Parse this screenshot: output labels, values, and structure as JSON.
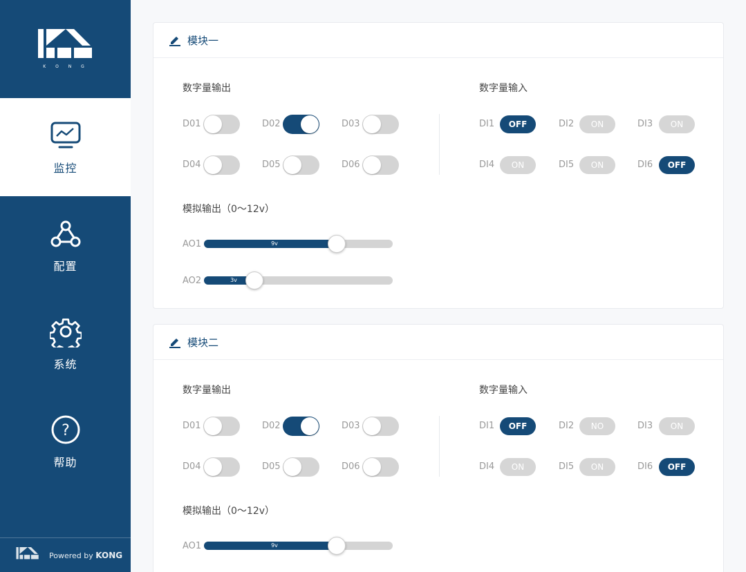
{
  "sidebar": {
    "logo_text": "K O N G",
    "items": [
      {
        "label": "监控",
        "icon": "monitor-icon",
        "active": true
      },
      {
        "label": "配置",
        "icon": "network-icon",
        "active": false
      },
      {
        "label": "系统",
        "icon": "gear-icon",
        "active": false
      },
      {
        "label": "帮助",
        "icon": "help-icon",
        "active": false
      }
    ],
    "footer": {
      "powered": "Powered by",
      "brand": "KONG"
    }
  },
  "colors": {
    "accent": "#154a77",
    "inactive": "#d4d4d4"
  },
  "modules": [
    {
      "title": "模块一",
      "digital_out_label": "数字量输出",
      "digital_in_label": "数字量输入",
      "analog_label": "模拟输出（0～12v）",
      "digital_outputs": [
        {
          "name": "D01",
          "on": false
        },
        {
          "name": "D02",
          "on": true
        },
        {
          "name": "D03",
          "on": false
        },
        {
          "name": "D04",
          "on": false
        },
        {
          "name": "D05",
          "on": false
        },
        {
          "name": "D06",
          "on": false
        }
      ],
      "digital_inputs": [
        {
          "name": "DI1",
          "state": "OFF",
          "active": true
        },
        {
          "name": "DI2",
          "state": "ON",
          "active": false
        },
        {
          "name": "DI3",
          "state": "ON",
          "active": false
        },
        {
          "name": "DI4",
          "state": "ON",
          "active": false
        },
        {
          "name": "DI5",
          "state": "ON",
          "active": false
        },
        {
          "name": "DI6",
          "state": "OFF",
          "active": true
        }
      ],
      "analog_outputs": [
        {
          "name": "AO1",
          "value_label": "9v",
          "value": 9
        },
        {
          "name": "AO2",
          "value_label": "3v",
          "value": 3
        }
      ]
    },
    {
      "title": "模块二",
      "digital_out_label": "数字量输出",
      "digital_in_label": "数字量输入",
      "analog_label": "模拟输出（0～12v）",
      "digital_outputs": [
        {
          "name": "D01",
          "on": false
        },
        {
          "name": "D02",
          "on": true
        },
        {
          "name": "D03",
          "on": false
        },
        {
          "name": "D04",
          "on": false
        },
        {
          "name": "D05",
          "on": false
        },
        {
          "name": "D06",
          "on": false
        }
      ],
      "digital_inputs": [
        {
          "name": "DI1",
          "state": "OFF",
          "active": true
        },
        {
          "name": "DI2",
          "state": "NO",
          "active": false
        },
        {
          "name": "DI3",
          "state": "ON",
          "active": false
        },
        {
          "name": "DI4",
          "state": "ON",
          "active": false
        },
        {
          "name": "DI5",
          "state": "ON",
          "active": false
        },
        {
          "name": "DI6",
          "state": "OFF",
          "active": true
        }
      ],
      "analog_outputs": [
        {
          "name": "AO1",
          "value_label": "9v",
          "value": 9
        }
      ]
    }
  ]
}
